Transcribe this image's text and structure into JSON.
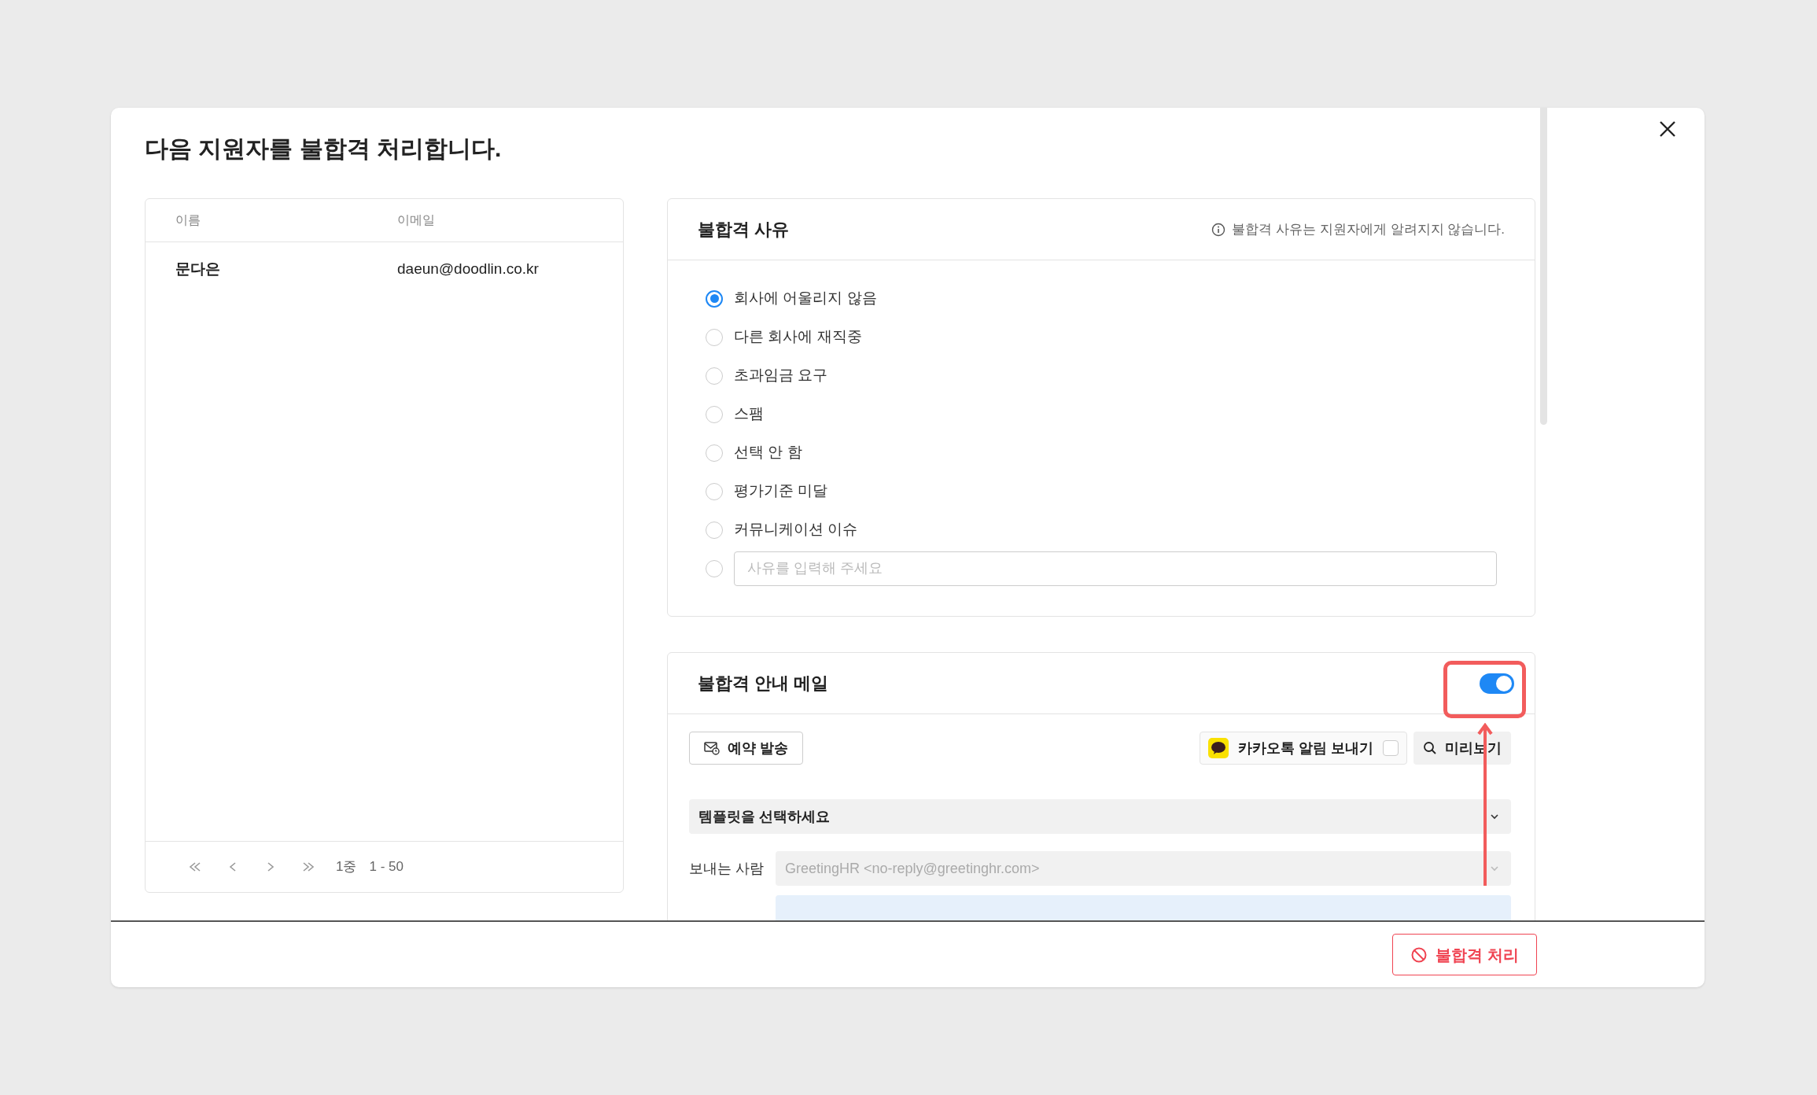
{
  "dialog": {
    "title": "다음 지원자를 불합격 처리합니다."
  },
  "applicants": {
    "columns": [
      "이름",
      "이메일"
    ],
    "rows": [
      {
        "name": "문다은",
        "email": "daeun@doodlin.co.kr"
      }
    ],
    "pagination": {
      "page": "1중",
      "range": "1 - 50"
    }
  },
  "reason": {
    "title": "불합격 사유",
    "notice": "불합격 사유는 지원자에게 알려지지 않습니다.",
    "options": [
      {
        "label": "회사에 어울리지 않음",
        "selected": true
      },
      {
        "label": "다른 회사에 재직중",
        "selected": false
      },
      {
        "label": "초과임금 요구",
        "selected": false
      },
      {
        "label": "스팸",
        "selected": false
      },
      {
        "label": "선택 안 함",
        "selected": false
      },
      {
        "label": "평가기준 미달",
        "selected": false
      },
      {
        "label": "커뮤니케이션 이슈",
        "selected": false
      }
    ],
    "custom": {
      "placeholder": "사유를 입력해 주세요",
      "selected": false
    }
  },
  "mail": {
    "title": "불합격 안내 메일",
    "on": true,
    "schedule_button": "예약 발송",
    "kakao": {
      "label": "카카오톡 알림 보내기",
      "checked": false
    },
    "preview_button": "미리보기",
    "template": {
      "value": "템플릿을 선택하세요"
    },
    "sender": {
      "label": "보내는 사람",
      "value": "GreetingHR <no-reply@greetinghr.com>",
      "disabled": true
    }
  },
  "footer": {
    "reject_button": "불합격 처리"
  }
}
